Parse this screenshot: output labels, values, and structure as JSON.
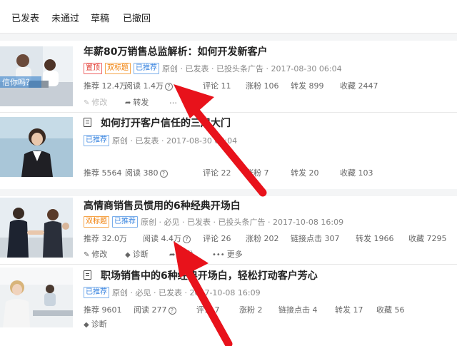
{
  "tabs": [
    "已发表",
    "未通过",
    "草稿",
    "已撤回"
  ],
  "articles": [
    {
      "title": "年薪80万销售总监解析：如何开发新客户",
      "tags": [
        "置顶",
        "双标题",
        "已推荐"
      ],
      "meta": "原创 · 已发表 · 已投头条广告 · 2017-08-30 06:04",
      "thumb_text": "信你吗？",
      "stats": [
        "推荐 12.4万",
        "阅读 1.4万",
        "评论 11",
        "涨粉 106",
        "转发 899",
        "收藏 2447"
      ],
      "actions": [
        "修改",
        "转发",
        "…"
      ]
    },
    {
      "title": "如何打开客户信任的三扇大门",
      "tags": [
        "已推荐"
      ],
      "meta": "原创 · 已发表 · 2017-08-30 06:04",
      "stats": [
        "推荐 5564",
        "阅读 380",
        "评论 22",
        "涨粉 7",
        "转发 20",
        "收藏 103"
      ]
    },
    {
      "title": "高情商销售员惯用的6种经典开场白",
      "tags": [
        "双标题",
        "已推荐"
      ],
      "meta": "原创 · 必见 · 已发表 · 已投头条广告 · 2017-10-08 16:09",
      "stats": [
        "推荐 32.0万",
        "阅读 4.4万",
        "评论 26",
        "涨粉 202",
        "链接点击 307",
        "转发 1966",
        "收藏 7295"
      ],
      "actions": [
        "修改",
        "诊断",
        "转发",
        "更多"
      ]
    },
    {
      "title": "职场销售中的6种经典开场白，轻松打动客户芳心",
      "tags": [
        "已推荐"
      ],
      "meta": "原创 · 必见 · 已发表 · 2017-10-08 16:09",
      "stats": [
        "推荐 9601",
        "阅读 277",
        "评论 7",
        "涨粉 2",
        "链接点击 4",
        "转发 17",
        "收藏 56"
      ],
      "actions": [
        "诊断"
      ]
    }
  ],
  "colors": {
    "arrow": "#e8121b",
    "tag_red": "#e03a2f",
    "tag_orange": "#f07c00",
    "tag_blue": "#3b86e0"
  }
}
